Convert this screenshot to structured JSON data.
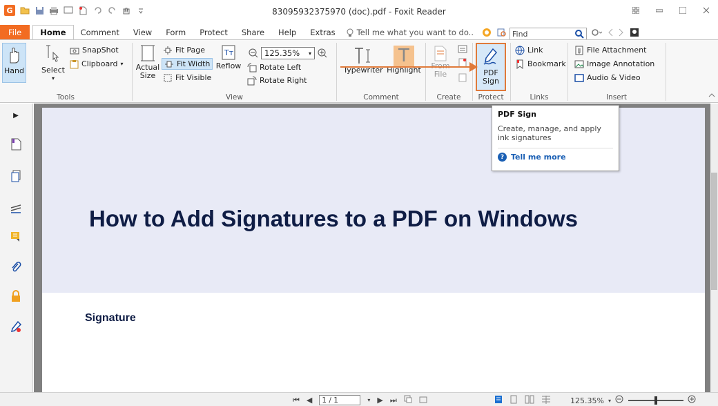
{
  "window": {
    "title": "83095932375970 (doc).pdf - Foxit Reader",
    "app_logo": "G"
  },
  "menu": {
    "tabs": [
      "File",
      "Home",
      "Comment",
      "View",
      "Form",
      "Protect",
      "Share",
      "Help",
      "Extras"
    ],
    "tell_me": "Tell me what you want to do..",
    "find_placeholder": "Find"
  },
  "ribbon": {
    "tools": {
      "hand": "Hand",
      "select": "Select",
      "snapshot": "SnapShot",
      "clipboard": "Clipboard",
      "group": "Tools"
    },
    "view": {
      "actual_size_1": "Actual",
      "actual_size_2": "Size",
      "fit_page": "Fit Page",
      "fit_width": "Fit Width",
      "fit_visible": "Fit Visible",
      "reflow": "Reflow",
      "zoom_value": "125.35%",
      "rotate_left": "Rotate Left",
      "rotate_right": "Rotate Right",
      "group": "View"
    },
    "comment": {
      "typewriter": "Typewriter",
      "highlight": "Highlight",
      "group": "Comment"
    },
    "create": {
      "from_1": "From",
      "from_2": "File",
      "group": "Create"
    },
    "protect": {
      "pdf_sign_1": "PDF",
      "pdf_sign_2": "Sign",
      "group": "Protect"
    },
    "links": {
      "link": "Link",
      "bookmark": "Bookmark",
      "group": "Links"
    },
    "insert": {
      "file_attachment": "File Attachment",
      "image_annotation": "Image Annotation",
      "audio_video": "Audio & Video",
      "group": "Insert"
    }
  },
  "tooltip": {
    "title": "PDF Sign",
    "description": "Create, manage, and apply ink signatures",
    "more": "Tell me more"
  },
  "document": {
    "title": "How to Add Signatures to a PDF on Windows",
    "section_heading": "Signature"
  },
  "statusbar": {
    "page_value": "1 / 1",
    "zoom": "125.35%"
  },
  "colors": {
    "accent_orange": "#f26c22",
    "header_band": "#e8eaf6",
    "title_navy": "#0f1d45",
    "annotation_arrow": "#e07a3a"
  }
}
